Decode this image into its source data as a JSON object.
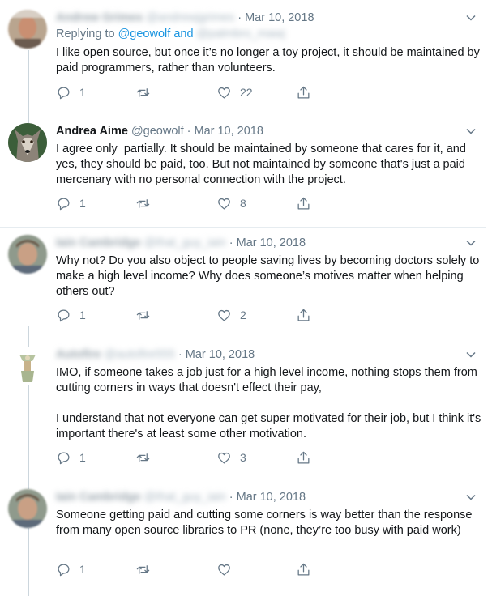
{
  "tweets": [
    {
      "name": "Andrew Grimes",
      "handle": "@andrewjgrimes",
      "date": "Mar 10, 2018",
      "replying_prefix": "Replying to",
      "replying_to_1": "@geowolf",
      "replying_and": "and",
      "replying_to_2": "@palmbro_mawj",
      "text": "I like open source, but once it’s no longer a toy project, it should be maintained by paid programmers, rather than volunteers.",
      "replies": "1",
      "retweets": "",
      "likes": "22"
    },
    {
      "name": "Andrea Aime",
      "handle": "@geowolf",
      "date": "Mar 10, 2018",
      "text": "I agree only  partially. It should be maintained by someone that cares for it, and yes, they should be paid, too. But not maintained by someone that's just a paid mercenary with no personal connection with the project.",
      "replies": "1",
      "retweets": "",
      "likes": "8"
    },
    {
      "name": "Iain Cambridge",
      "handle": "@that_guy_iain",
      "date": "Mar 10, 2018",
      "text": "Why not? Do you also object to people saving lives by becoming doctors solely to make a high level income? Why does someone’s motives matter when helping others out?",
      "replies": "1",
      "retweets": "",
      "likes": "2"
    },
    {
      "name": "Autofire",
      "handle": "@autofire555",
      "date": "Mar 10, 2018",
      "text": "IMO, if someone takes a job just for a high level income, nothing stops them from cutting corners in ways that doesn't effect their pay,\n\nI understand that not everyone can get super motivated for their job, but I think it's important there's at least some other motivation.",
      "replies": "1",
      "retweets": "",
      "likes": "3"
    },
    {
      "name": "Iain Cambridge",
      "handle": "@that_guy_iain",
      "date": "Mar 10, 2018",
      "text": "Someone getting paid and cutting some corners is way better than the response from many open source libraries to PR (none, they’re too busy with paid work)",
      "replies": "1",
      "retweets": "",
      "likes": ""
    }
  ],
  "icons": {
    "reply": "reply-icon",
    "retweet": "retweet-icon",
    "like": "heart-icon",
    "share": "share-icon",
    "caret": "chevron-down-icon"
  },
  "colors": {
    "link": "#1b95e0",
    "muted": "#657786",
    "thread_line": "#ccd6dd"
  }
}
